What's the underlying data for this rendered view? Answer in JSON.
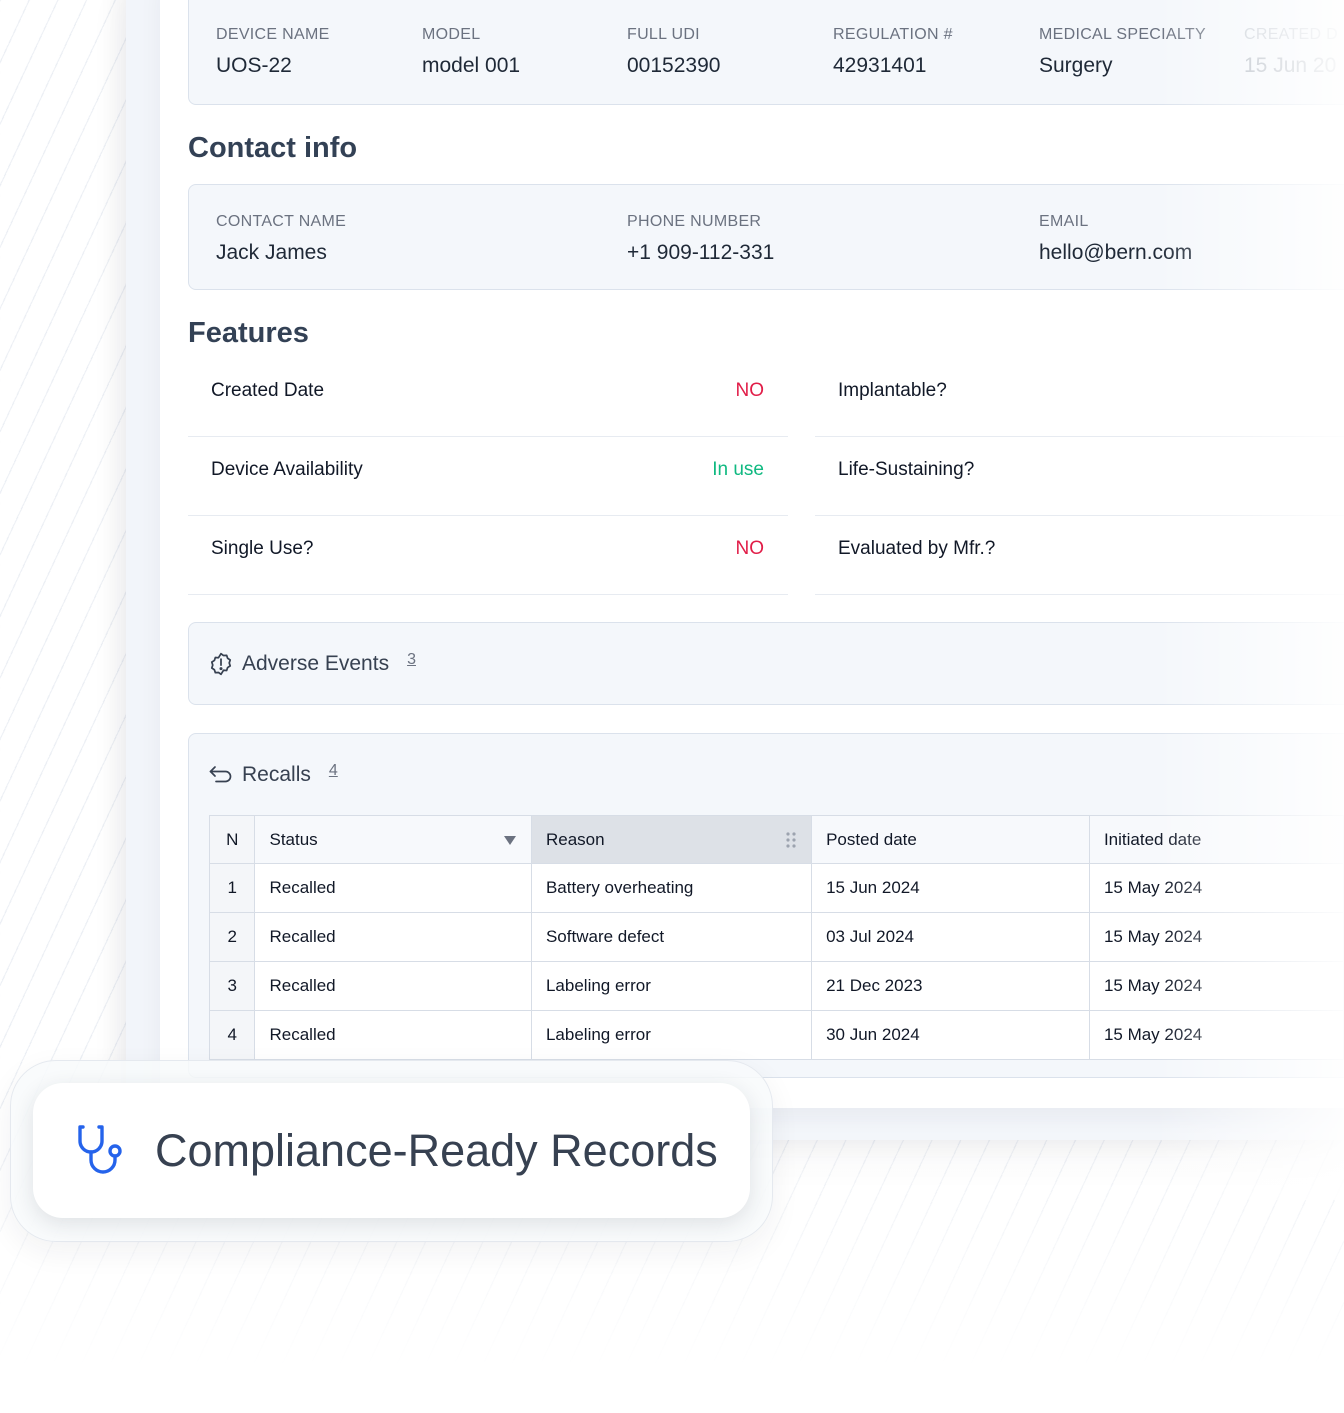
{
  "device": {
    "fields": [
      {
        "label": "DEVICE NAME",
        "value": "UOS-22"
      },
      {
        "label": "MODEL",
        "value": "model 001"
      },
      {
        "label": "FULL UDI",
        "value": "00152390"
      },
      {
        "label": "REGULATION #",
        "value": "42931401"
      },
      {
        "label": "MEDICAL SPECIALTY",
        "value": "Surgery"
      },
      {
        "label": "CREATED D",
        "value": "15 Jun 20"
      }
    ]
  },
  "contact": {
    "title": "Contact info",
    "fields": [
      {
        "label": "CONTACT NAME",
        "value": "Jack James"
      },
      {
        "label": "PHONE NUMBER",
        "value": "+1 909-112-331"
      },
      {
        "label": "EMAIL",
        "value": "hello@bern.com"
      }
    ]
  },
  "features": {
    "title": "Features",
    "left": [
      {
        "label": "Created Date",
        "value": "NO",
        "color": "#e11d48"
      },
      {
        "label": "Device Availability",
        "value": "In use",
        "color": "#10b981"
      },
      {
        "label": "Single Use?",
        "value": "NO",
        "color": "#e11d48"
      }
    ],
    "right": [
      {
        "label": "Implantable?"
      },
      {
        "label": "Life-Sustaining?"
      },
      {
        "label": "Evaluated by Mfr.?"
      }
    ]
  },
  "adverse_events": {
    "title": "Adverse Events",
    "count": "3",
    "icon": "alert-badge-icon"
  },
  "recalls": {
    "title": "Recalls",
    "count": "4",
    "icon": "return-arrow-icon",
    "columns": [
      "N",
      "Status",
      "Reason",
      "Posted date",
      "Initiated date"
    ],
    "rows": [
      {
        "n": "1",
        "status": "Recalled",
        "reason": "Battery overheating",
        "posted": "15 Jun 2024",
        "initiated": "15 May 2024"
      },
      {
        "n": "2",
        "status": "Recalled",
        "reason": "Software defect",
        "posted": "03 Jul 2024",
        "initiated": "15 May 2024"
      },
      {
        "n": "3",
        "status": "Recalled",
        "reason": "Labeling error",
        "posted": "21 Dec 2023",
        "initiated": "15 May 2024"
      },
      {
        "n": "4",
        "status": "Recalled",
        "reason": "Labeling error",
        "posted": "30 Jun 2024",
        "initiated": "15 May 2024"
      }
    ]
  },
  "badge": {
    "text": "Compliance-Ready Records",
    "icon": "stethoscope-icon",
    "accent": "#2563eb"
  }
}
